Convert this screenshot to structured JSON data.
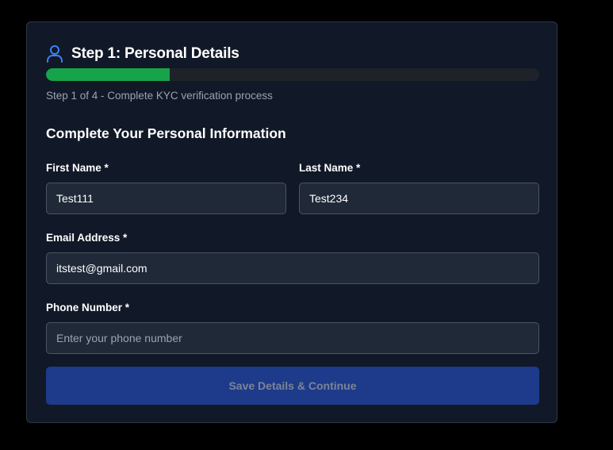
{
  "header": {
    "icon": "user-icon",
    "title": "Step 1: Personal Details"
  },
  "progress": {
    "fraction": 0.25,
    "step_text": "Step 1 of 4 - Complete KYC verification process"
  },
  "form": {
    "section_title": "Complete Your Personal Information",
    "first_name": {
      "label": "First Name *",
      "value": "Test111"
    },
    "last_name": {
      "label": "Last Name *",
      "value": "Test234"
    },
    "email": {
      "label": "Email Address *",
      "value": "itstest@gmail.com"
    },
    "phone": {
      "label": "Phone Number *",
      "value": "",
      "placeholder": "Enter your phone number"
    },
    "submit_label": "Save Details & Continue"
  },
  "colors": {
    "accent_blue": "#3b82f6",
    "progress_green": "#16a34a",
    "button_bg": "#1e3a8a"
  }
}
